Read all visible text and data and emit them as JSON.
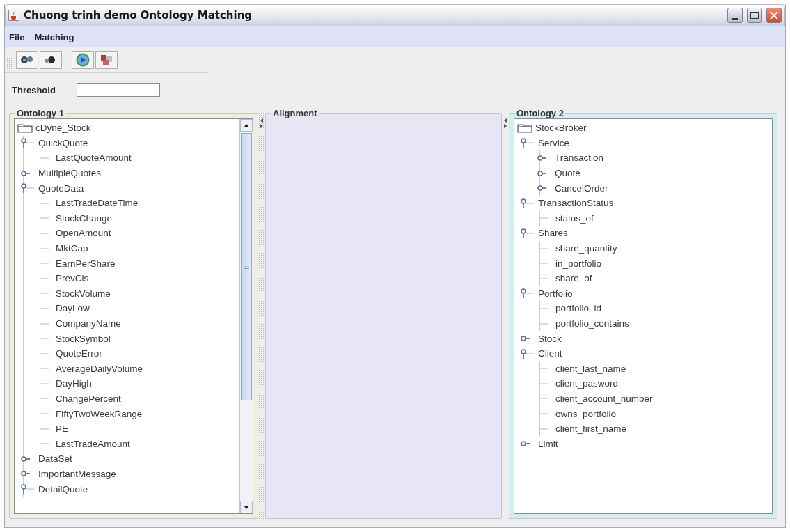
{
  "window": {
    "title": "Chuong trinh demo Ontology Matching"
  },
  "menu": [
    {
      "label": "File"
    },
    {
      "label": "Matching"
    }
  ],
  "threshold": {
    "label": "Threshold"
  },
  "ontology_1": {
    "title": "Ontology 1",
    "tree": {
      "label": "cDyne_Stock",
      "kind": "root",
      "children": [
        {
          "label": "QuickQuote",
          "kind": "node",
          "expanded": true,
          "children": [
            {
              "label": "LastQuoteAmount",
              "kind": "leaf"
            }
          ]
        },
        {
          "label": "MultipleQuotes",
          "kind": "node",
          "expanded": false
        },
        {
          "label": "QuoteData",
          "kind": "node",
          "expanded": true,
          "children": [
            {
              "label": "LastTradeDateTime",
              "kind": "leaf"
            },
            {
              "label": "StockChange",
              "kind": "leaf"
            },
            {
              "label": "OpenAmount",
              "kind": "leaf"
            },
            {
              "label": "MktCap",
              "kind": "leaf"
            },
            {
              "label": "EarnPerShare",
              "kind": "leaf"
            },
            {
              "label": "PrevCls",
              "kind": "leaf"
            },
            {
              "label": "StockVolume",
              "kind": "leaf"
            },
            {
              "label": "DayLow",
              "kind": "leaf"
            },
            {
              "label": "CompanyName",
              "kind": "leaf"
            },
            {
              "label": "StockSymbol",
              "kind": "leaf"
            },
            {
              "label": "QuoteError",
              "kind": "leaf"
            },
            {
              "label": "AverageDailyVolume",
              "kind": "leaf"
            },
            {
              "label": "DayHigh",
              "kind": "leaf"
            },
            {
              "label": "ChangePercent",
              "kind": "leaf"
            },
            {
              "label": "FiftyTwoWeekRange",
              "kind": "leaf"
            },
            {
              "label": "PE",
              "kind": "leaf"
            },
            {
              "label": "LastTradeAmount",
              "kind": "leaf"
            }
          ]
        },
        {
          "label": "DataSet",
          "kind": "node",
          "expanded": false
        },
        {
          "label": "ImportantMessage",
          "kind": "node",
          "expanded": false
        },
        {
          "label": "DetailQuote",
          "kind": "node",
          "expanded": true
        }
      ]
    }
  },
  "alignment": {
    "title": "Alignment"
  },
  "ontology_2": {
    "title": "Ontology 2",
    "tree": {
      "label": "StockBroker",
      "kind": "root",
      "children": [
        {
          "label": "Service",
          "kind": "node",
          "expanded": true,
          "children": [
            {
              "label": "Transaction",
              "kind": "node",
              "expanded": false
            },
            {
              "label": "Quote",
              "kind": "node",
              "expanded": false
            },
            {
              "label": "CancelOrder",
              "kind": "node",
              "expanded": false
            }
          ]
        },
        {
          "label": "TransactionStatus",
          "kind": "node",
          "expanded": true,
          "children": [
            {
              "label": "status_of",
              "kind": "leaf"
            }
          ]
        },
        {
          "label": "Shares",
          "kind": "node",
          "expanded": true,
          "children": [
            {
              "label": "share_quantity",
              "kind": "leaf"
            },
            {
              "label": "in_portfolio",
              "kind": "leaf"
            },
            {
              "label": "share_of",
              "kind": "leaf"
            }
          ]
        },
        {
          "label": "Portfolio",
          "kind": "node",
          "expanded": true,
          "children": [
            {
              "label": "portfolio_id",
              "kind": "leaf"
            },
            {
              "label": "portfolio_contains",
              "kind": "leaf"
            }
          ]
        },
        {
          "label": "Stock",
          "kind": "node",
          "expanded": false
        },
        {
          "label": "Client",
          "kind": "node",
          "expanded": true,
          "children": [
            {
              "label": "client_last_name",
              "kind": "leaf"
            },
            {
              "label": "client_pasword",
              "kind": "leaf"
            },
            {
              "label": "client_account_number",
              "kind": "leaf"
            },
            {
              "label": "owns_portfolio",
              "kind": "leaf"
            },
            {
              "label": "client_first_name",
              "kind": "leaf"
            }
          ]
        },
        {
          "label": "Limit",
          "kind": "node",
          "expanded": false
        }
      ]
    }
  }
}
